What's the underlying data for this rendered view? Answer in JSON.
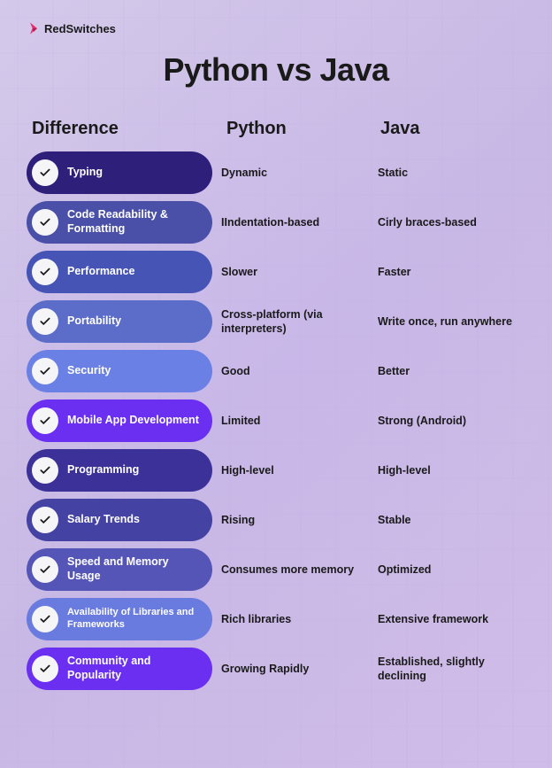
{
  "brand": "RedSwitches",
  "title": "Python vs Java",
  "columns": {
    "diff": "Difference",
    "python": "Python",
    "java": "Java"
  },
  "rows": [
    {
      "label": "Typing",
      "python": "Dynamic",
      "java": "Static",
      "color": "#2d1f7a"
    },
    {
      "label": "Code Readability & Formatting",
      "python": "IIndentation-based",
      "java": "Cirly braces-based",
      "color": "#4a4fa8"
    },
    {
      "label": "Performance",
      "python": "Slower",
      "java": "Faster",
      "color": "#4654b5"
    },
    {
      "label": "Portability",
      "python": "Cross-platform (via interpreters)",
      "java": "Write once, run anywhere",
      "color": "#5b6dc9"
    },
    {
      "label": "Security",
      "python": "Good",
      "java": "Better",
      "color": "#6b80e5"
    },
    {
      "label": "Mobile App Development",
      "python": "Limited",
      "java": "Strong (Android)",
      "color": "#6a2ff0"
    },
    {
      "label": "Programming",
      "python": "High-level",
      "java": "High-level",
      "color": "#3b3199"
    },
    {
      "label": "Salary Trends",
      "python": "Rising",
      "java": "Stable",
      "color": "#4442a3"
    },
    {
      "label": "Speed and Memory Usage",
      "python": "Consumes more memory",
      "java": "Optimized",
      "color": "#5555b8"
    },
    {
      "label": "Availability of Libraries and Frameworks",
      "python": "Rich libraries",
      "java": "Extensive framework",
      "color": "#6a7be0"
    },
    {
      "label": "Community and Popularity",
      "python": "Growing Rapidly",
      "java": "Established, slightly declining",
      "color": "#6a2ff0"
    }
  ]
}
